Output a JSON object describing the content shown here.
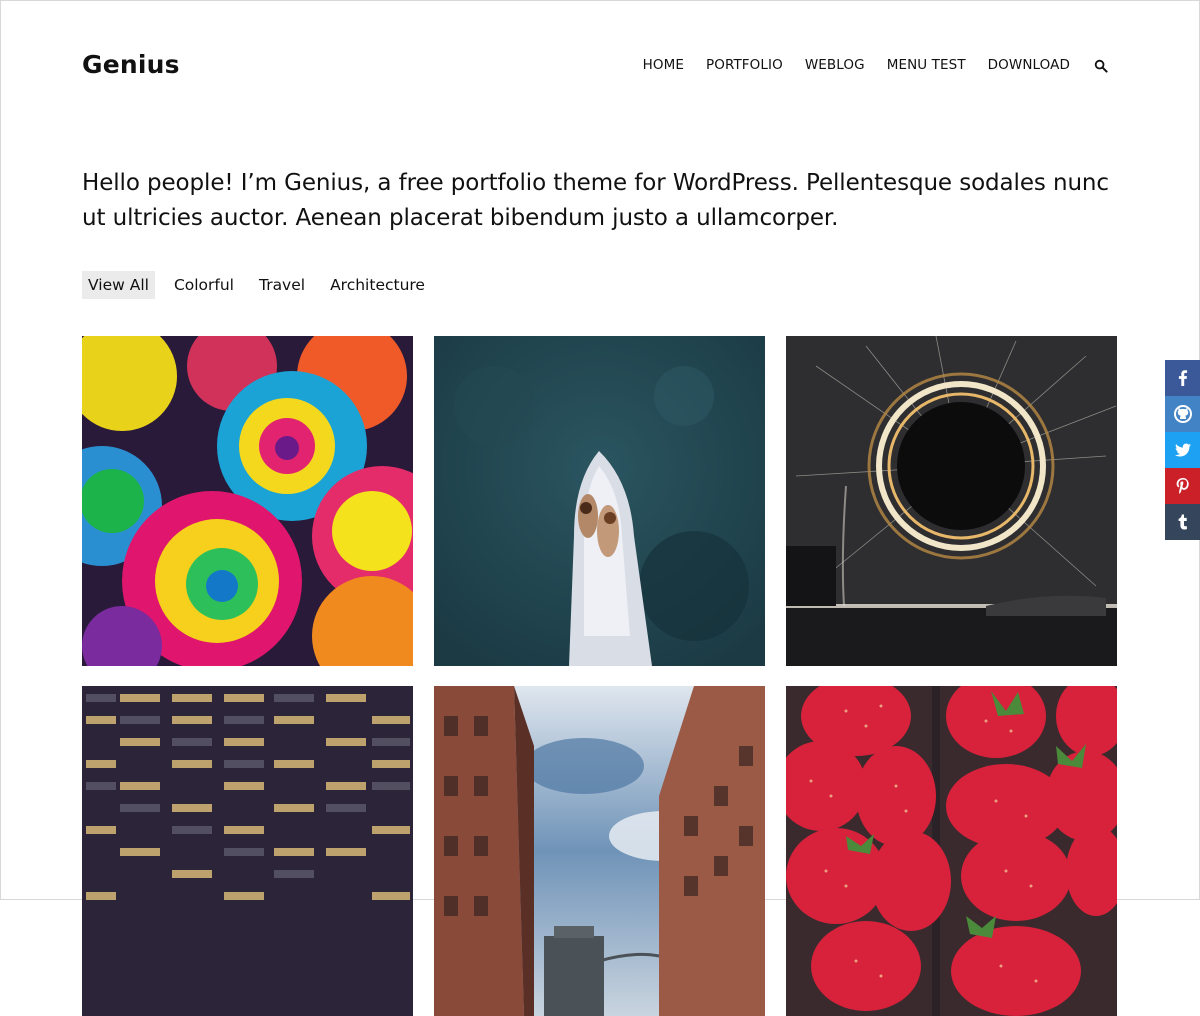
{
  "site": {
    "title": "Genius"
  },
  "nav": {
    "items": [
      {
        "label": "HOME"
      },
      {
        "label": "PORTFOLIO"
      },
      {
        "label": "WEBLOG"
      },
      {
        "label": "MENU TEST"
      },
      {
        "label": "DOWNLOAD"
      }
    ],
    "search_icon": "search-icon"
  },
  "intro": {
    "text": "Hello people! I’m Genius, a free portfolio theme for WordPress. Pellentesque sodales nunc ut ultricies auctor. Aenean placerat bibendum justo a ullamcorper."
  },
  "filters": {
    "items": [
      {
        "label": "View All",
        "active": true
      },
      {
        "label": "Colorful",
        "active": false
      },
      {
        "label": "Travel",
        "active": false
      },
      {
        "label": "Architecture",
        "active": false
      }
    ]
  },
  "portfolio": {
    "items": [
      {
        "subject": "rainbow roses"
      },
      {
        "subject": "couple lying on boat bow"
      },
      {
        "subject": "steel wool spinning light"
      },
      {
        "subject": "office building windows at night"
      },
      {
        "subject": "brick buildings and bridge"
      },
      {
        "subject": "strawberries"
      }
    ]
  },
  "share": {
    "buttons": [
      {
        "icon": "facebook-icon",
        "color": "#3b5998"
      },
      {
        "icon": "github-icon",
        "color": "#4183c4"
      },
      {
        "icon": "twitter-icon",
        "color": "#1da1f2"
      },
      {
        "icon": "pinterest-icon",
        "color": "#cb2027"
      },
      {
        "icon": "tumblr-icon",
        "color": "#35465c"
      }
    ]
  }
}
